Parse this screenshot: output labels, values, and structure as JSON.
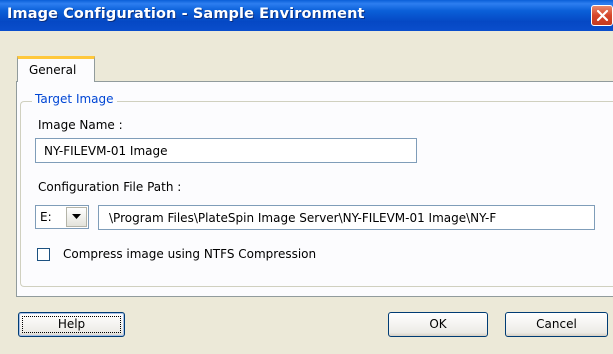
{
  "window": {
    "title": "Image Configuration - Sample Environment"
  },
  "tabs": [
    {
      "label": "General",
      "active": true
    }
  ],
  "target_image": {
    "group_label": "Target Image",
    "image_name_label": "Image Name :",
    "image_name_value": "NY-FILEVM-01 Image",
    "config_path_label": "Configuration File Path :",
    "drive_value": "E:",
    "config_path_value": "\\Program Files\\PlateSpin Image Server\\NY-FILEVM-01 Image\\NY-F",
    "compress_label": "Compress image using NTFS Compression",
    "compress_checked": false
  },
  "buttons": {
    "help": "Help",
    "ok": "OK",
    "cancel": "Cancel"
  },
  "colors": {
    "titlebar": "#0a5fd8",
    "dialog_bg": "#ece9d8",
    "group_label": "#0046d5",
    "tab_highlight": "#ffc83c"
  }
}
